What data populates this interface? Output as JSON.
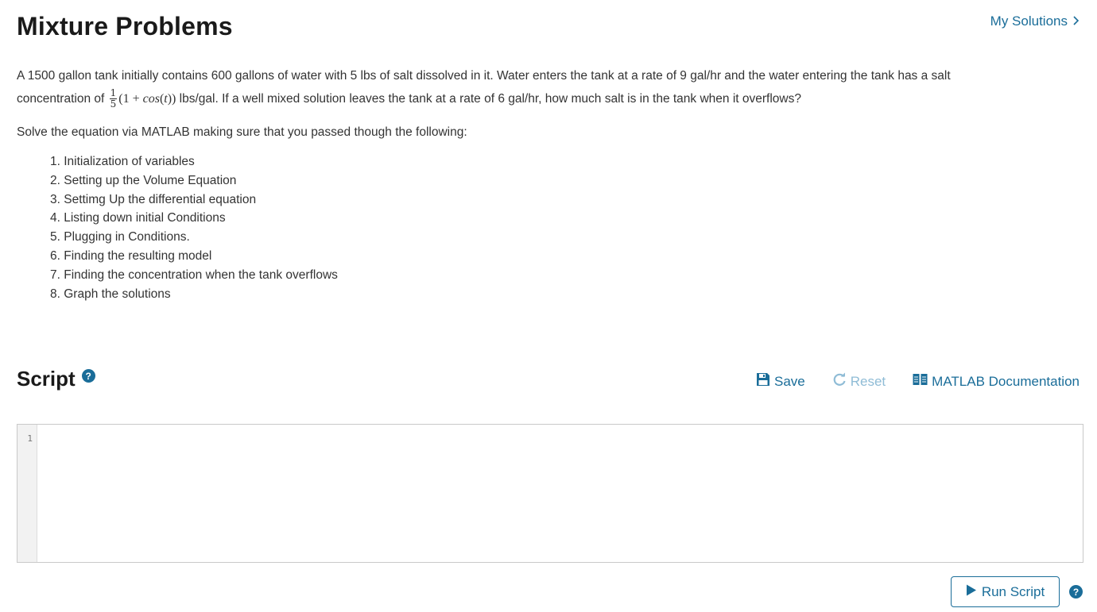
{
  "header": {
    "title": "Mixture Problems",
    "my_solutions": "My Solutions"
  },
  "problem": {
    "line1": "A 1500 gallon tank initially contains 600 gallons of water with 5 lbs of salt dissolved in it. Water enters the tank at a rate of 9 gal/hr and the water entering the tank has a salt",
    "line2_pre": "concentration of",
    "frac_num": "1",
    "frac_den": "5",
    "math_open": "(1 + ",
    "math_fn": "cos",
    "math_arg_open": "(",
    "math_var": "t",
    "math_close": "))",
    "line2_post": " lbs/gal. If a well mixed solution leaves the tank at a rate of 6 gal/hr, how much salt is in the tank when it overflows?"
  },
  "instructions": "Solve the equation via MATLAB making sure that you passed though the following:",
  "steps": [
    "1. Initialization of variables",
    "2. Setting up the Volume Equation",
    "3. Settimg Up the differential equation",
    "4. Listing down initial Conditions",
    "5. Plugging in Conditions.",
    "6. Finding the resulting model",
    "7. Finding the concentration when the tank overflows",
    "8. Graph the solutions"
  ],
  "script": {
    "title": "Script",
    "help_glyph": "?",
    "save_label": "Save",
    "reset_label": "Reset",
    "doc_label": "MATLAB Documentation",
    "line_number": "1"
  },
  "run": {
    "label": "Run Script",
    "help_glyph": "?"
  },
  "colors": {
    "accent": "#1a6d99",
    "disabled": "#8fbcd6"
  },
  "icons": {
    "save": "floppy-disk-icon",
    "reset": "circular-arrow-icon",
    "doc": "book-icon",
    "run": "play-triangle-icon",
    "my_solutions": "chevron-right-icon"
  }
}
